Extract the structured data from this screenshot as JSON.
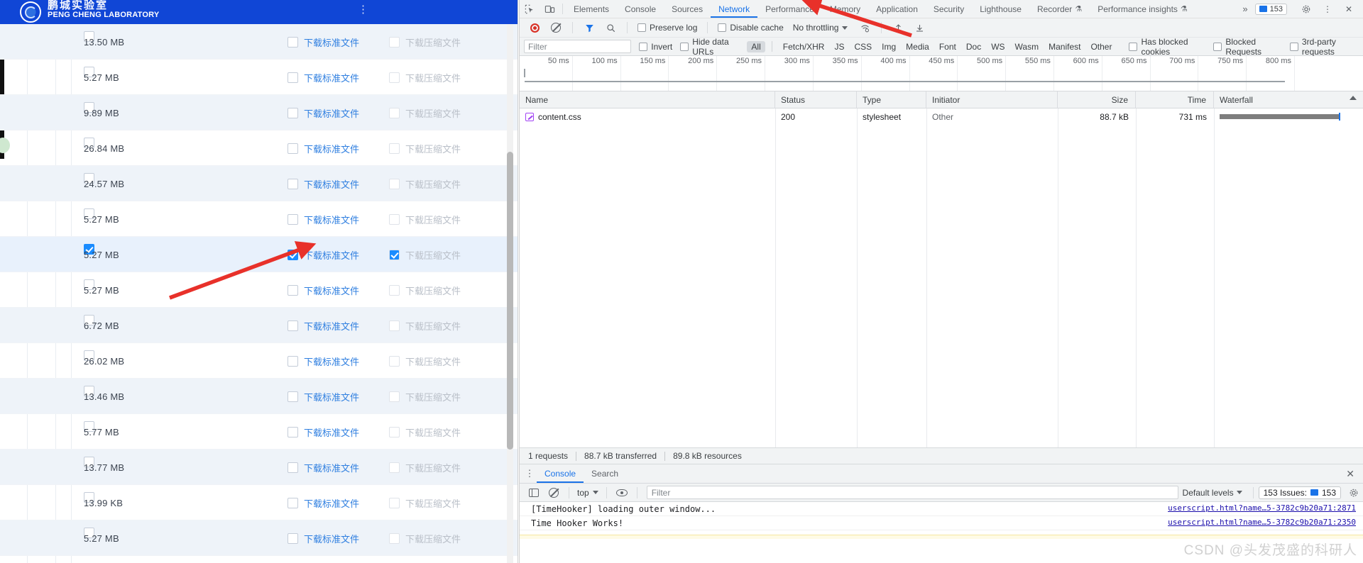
{
  "webpage": {
    "brand": {
      "name_cn": "鹏城实验室",
      "name_en": "PENG CHENG LABORATORY",
      "logo_icon": "seal-logo-icon"
    },
    "columns": {
      "download_standard": "下载标准文件",
      "download_compressed": "下载压缩文件"
    },
    "rows": [
      {
        "size": "13.50 MB",
        "row_checked": false,
        "std_checked": false,
        "zip_checked": false
      },
      {
        "size": "5.27 MB",
        "row_checked": false,
        "std_checked": false,
        "zip_checked": false
      },
      {
        "size": "9.89 MB",
        "row_checked": false,
        "std_checked": false,
        "zip_checked": false
      },
      {
        "size": "26.84 MB",
        "row_checked": false,
        "std_checked": false,
        "zip_checked": false
      },
      {
        "size": "24.57 MB",
        "row_checked": false,
        "std_checked": false,
        "zip_checked": false
      },
      {
        "size": "5.27 MB",
        "row_checked": false,
        "std_checked": false,
        "zip_checked": false
      },
      {
        "size": "5.27 MB",
        "row_checked": true,
        "std_checked": true,
        "zip_checked": true
      },
      {
        "size": "5.27 MB",
        "row_checked": false,
        "std_checked": false,
        "zip_checked": false
      },
      {
        "size": "6.72 MB",
        "row_checked": false,
        "std_checked": false,
        "zip_checked": false
      },
      {
        "size": "26.02 MB",
        "row_checked": false,
        "std_checked": false,
        "zip_checked": false
      },
      {
        "size": "13.46 MB",
        "row_checked": false,
        "std_checked": false,
        "zip_checked": false
      },
      {
        "size": "5.77 MB",
        "row_checked": false,
        "std_checked": false,
        "zip_checked": false
      },
      {
        "size": "13.77 MB",
        "row_checked": false,
        "std_checked": false,
        "zip_checked": false
      },
      {
        "size": "13.99 KB",
        "row_checked": false,
        "std_checked": false,
        "zip_checked": false
      },
      {
        "size": "5.27 MB",
        "row_checked": false,
        "std_checked": false,
        "zip_checked": false
      }
    ]
  },
  "devtools": {
    "tabs": [
      {
        "label": "Elements",
        "active": false
      },
      {
        "label": "Console",
        "active": false
      },
      {
        "label": "Sources",
        "active": false
      },
      {
        "label": "Network",
        "active": true
      },
      {
        "label": "Performance",
        "active": false
      },
      {
        "label": "Memory",
        "active": false
      },
      {
        "label": "Application",
        "active": false
      },
      {
        "label": "Security",
        "active": false
      },
      {
        "label": "Lighthouse",
        "active": false
      },
      {
        "label": "Recorder",
        "active": false,
        "experimental": true
      },
      {
        "label": "Performance insights",
        "active": false,
        "experimental": true
      }
    ],
    "tabbar": {
      "inspect_icon": "inspect-element-icon",
      "device_icon": "device-toolbar-icon",
      "more_tabs": "»",
      "issues_count": "153",
      "settings_icon": "gear-icon",
      "menu_icon": "kebab-menu-icon",
      "close_icon": "close-icon"
    },
    "network_toolbar": {
      "record_icon": "record-stop-icon",
      "clear_icon": "clear-icon",
      "filter_icon": "funnel-icon",
      "search_icon": "search-icon",
      "preserve_log": {
        "label": "Preserve log",
        "checked": false
      },
      "disable_cache": {
        "label": "Disable cache",
        "checked": false
      },
      "throttling": "No throttling",
      "wifi_icon": "network-conditions-icon",
      "import_icon": "import-har-icon",
      "export_icon": "export-har-icon"
    },
    "filter_bar": {
      "filter_placeholder": "Filter",
      "filter_value": "",
      "invert": {
        "label": "Invert",
        "checked": false
      },
      "hide_data_urls": {
        "label": "Hide data URLs",
        "checked": false
      },
      "types": [
        "All",
        "Fetch/XHR",
        "JS",
        "CSS",
        "Img",
        "Media",
        "Font",
        "Doc",
        "WS",
        "Wasm",
        "Manifest",
        "Other"
      ],
      "active_type": "All",
      "has_blocked_cookies": {
        "label": "Has blocked cookies",
        "checked": false
      },
      "blocked_requests": {
        "label": "Blocked Requests",
        "checked": false
      },
      "third_party": {
        "label": "3rd-party requests",
        "checked": false
      }
    },
    "overview_ticks": [
      "50 ms",
      "100 ms",
      "150 ms",
      "200 ms",
      "250 ms",
      "300 ms",
      "350 ms",
      "400 ms",
      "450 ms",
      "500 ms",
      "550 ms",
      "600 ms",
      "650 ms",
      "700 ms",
      "750 ms",
      "800 ms"
    ],
    "table": {
      "headers": [
        "Name",
        "Status",
        "Type",
        "Initiator",
        "Size",
        "Time",
        "Waterfall"
      ],
      "sorted_column": "Waterfall",
      "rows": [
        {
          "name": "content.css",
          "icon": "stylesheet-icon",
          "status": "200",
          "type": "stylesheet",
          "initiator": "Other",
          "size": "88.7 kB",
          "time": "731 ms"
        }
      ]
    },
    "summary": {
      "requests": "1 requests",
      "transferred": "88.7 kB transferred",
      "resources": "89.8 kB resources"
    },
    "drawer": {
      "tabs": [
        {
          "label": "Console",
          "active": true
        },
        {
          "label": "Search",
          "active": false
        }
      ],
      "close_icon": "close-icon",
      "console_toolbar": {
        "sidebar_icon": "console-sidebar-icon",
        "clear_icon": "clear-console-icon",
        "context": "top",
        "eye_icon": "live-expression-icon",
        "filter_placeholder": "Filter",
        "filter_value": "",
        "levels": "Default levels",
        "issues_label": "153 Issues:",
        "issues_count": "153",
        "settings_icon": "gear-icon"
      },
      "messages": [
        {
          "text": "[TimeHooker] loading outer window...",
          "source": "userscript.html?name…5-3782c9b20a71:2871"
        },
        {
          "text": "Time Hooker Works!",
          "source": "userscript.html?name…5-3782c9b20a71:2350"
        }
      ]
    }
  },
  "annotations": {
    "watermark": "CSDN @头发茂盛的科研人",
    "arrow_color": "#e8312a"
  }
}
